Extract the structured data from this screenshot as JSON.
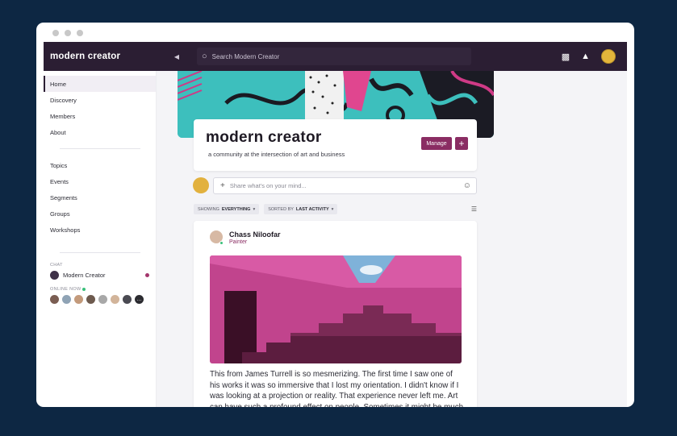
{
  "app": {
    "brand": "modern creator",
    "search_placeholder": "Search Modern Creator"
  },
  "sidebar": {
    "nav_primary": [
      {
        "label": "Home",
        "active": true
      },
      {
        "label": "Discovery"
      },
      {
        "label": "Members"
      },
      {
        "label": "About"
      }
    ],
    "nav_secondary": [
      {
        "label": "Topics"
      },
      {
        "label": "Events"
      },
      {
        "label": "Segments"
      },
      {
        "label": "Groups"
      },
      {
        "label": "Workshops"
      }
    ],
    "chat_label": "CHAT",
    "chat_item": "Modern Creator",
    "online_label": "ONLINE NOW"
  },
  "community": {
    "title": "modern creator",
    "subtitle": "a community at the intersection of art and business",
    "manage_label": "Manage",
    "add_label": "+"
  },
  "composer": {
    "placeholder": "Share what's on your mind..."
  },
  "filters": {
    "showing_prefix": "SHOWING",
    "showing_value": "EVERYTHING",
    "sorted_prefix": "SORTED BY",
    "sorted_value": "LAST ACTIVITY"
  },
  "post": {
    "author": "Chass Niloofar",
    "role": "Painter",
    "body": "This from James Turrell is so mesmerizing. The first time I saw one of his works it was so immersive that I lost my orientation. I didn't know if I was looking at a projection or reality. That experience never left me. Art can have such a profound effect on people. Sometimes it might be much"
  },
  "colors": {
    "topbar": "#2b1e33",
    "accent": "#8a2d63",
    "online": "#38c07a"
  }
}
